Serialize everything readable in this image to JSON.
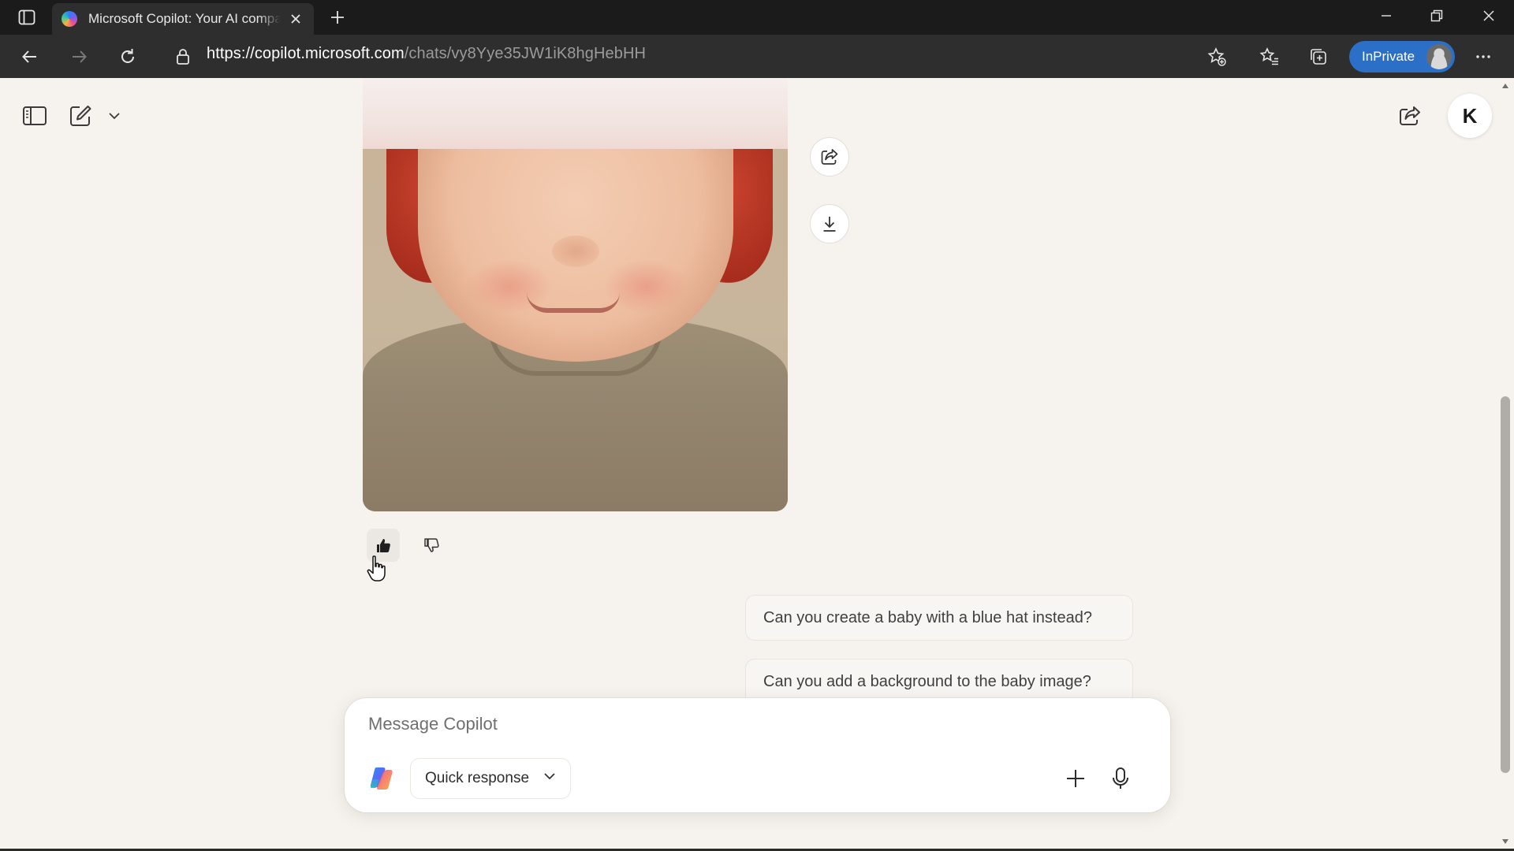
{
  "browser": {
    "tab": {
      "title": "Microsoft Copilot: Your AI companion"
    },
    "address": {
      "host_part": "https://copilot.microsoft.com",
      "path_part": "/chats/vy8Yye35JW1iK8hgHebHH"
    },
    "inprivate_label": "InPrivate",
    "accent_color": "#2b6fc6"
  },
  "header": {
    "avatar_initial": "K"
  },
  "chat": {
    "suggestions": [
      "Can you create a baby with a blue hat instead?",
      "Can you add a background to the baby image?"
    ]
  },
  "composer": {
    "placeholder": "Message Copilot",
    "mode_label": "Quick response"
  }
}
